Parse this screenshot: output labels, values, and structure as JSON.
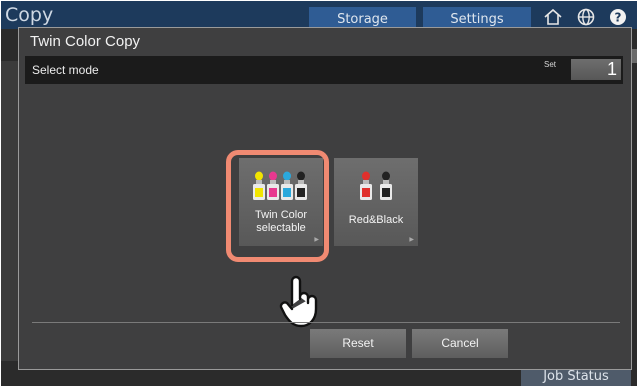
{
  "app": {
    "title": "Copy",
    "tabs": [
      "Storage",
      "Settings"
    ],
    "header_icons": [
      "home-icon",
      "globe-icon",
      "help-icon"
    ],
    "job_status_label": "Job Status"
  },
  "dialog": {
    "title": "Twin Color Copy",
    "mode_bar": {
      "label": "Select mode",
      "set_label": "Set",
      "set_value": "1"
    },
    "modes": [
      {
        "label_line1": "Twin Color",
        "label_line2": "selectable",
        "icon": "four-color-bottles-icon",
        "selected": true
      },
      {
        "label_line1": "Red&Black",
        "label_line2": "",
        "icon": "red-black-bottles-icon",
        "selected": false
      }
    ],
    "buttons": {
      "reset": "Reset",
      "cancel": "Cancel"
    }
  },
  "colors": {
    "yellow": "#f2e500",
    "magenta": "#e8388f",
    "cyan": "#2aa8dc",
    "black": "#222222",
    "red": "#e0302c",
    "highlight": "#f08a72"
  },
  "overlay": {
    "pointer_icon": "hand-pointer-icon"
  }
}
